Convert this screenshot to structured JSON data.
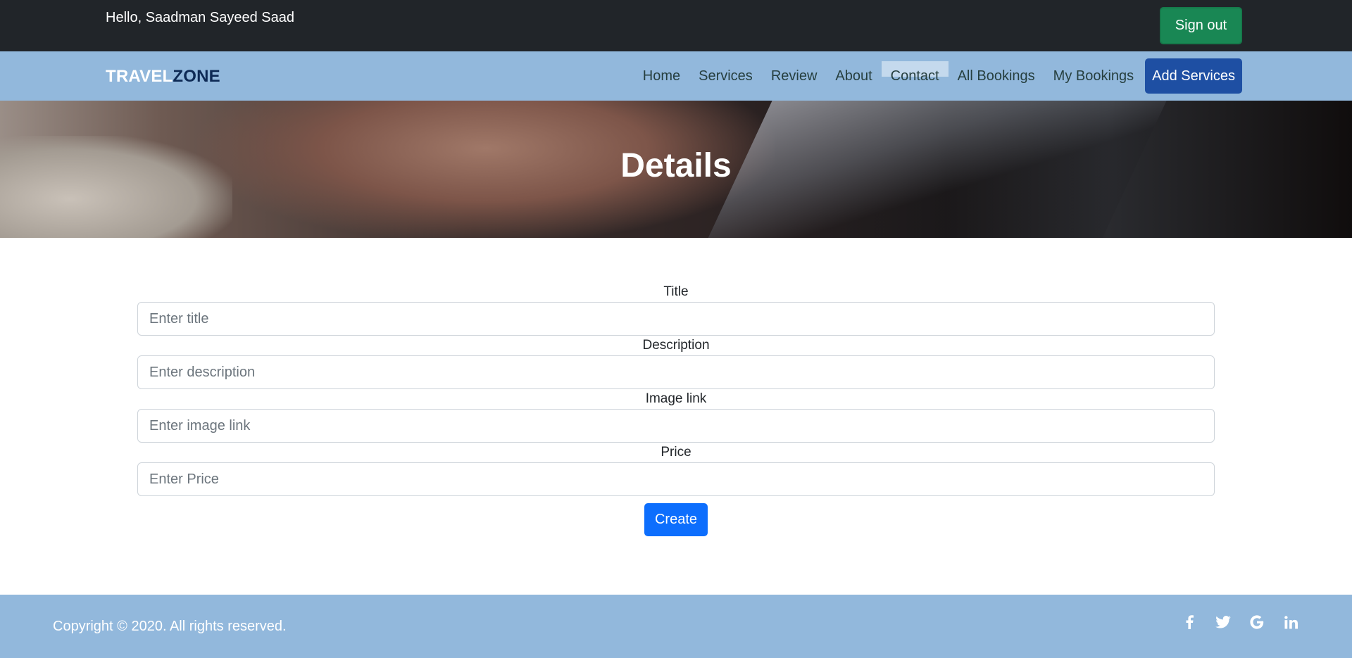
{
  "topbar": {
    "greeting": "Hello, Saadman Sayeed Saad",
    "signout_label": "Sign out"
  },
  "navbar": {
    "brand_part1": "TRAVEL",
    "brand_part2": "ZONE",
    "links": [
      {
        "label": "Home"
      },
      {
        "label": "Services"
      },
      {
        "label": "Review"
      },
      {
        "label": "About"
      },
      {
        "label": "Contact"
      },
      {
        "label": "All Bookings"
      },
      {
        "label": "My Bookings"
      }
    ],
    "add_services_label": "Add Services"
  },
  "hero": {
    "title": "Details"
  },
  "form": {
    "fields": [
      {
        "label": "Title",
        "placeholder": "Enter title",
        "value": ""
      },
      {
        "label": "Description",
        "placeholder": "Enter description",
        "value": ""
      },
      {
        "label": "Image link",
        "placeholder": "Enter image link",
        "value": ""
      },
      {
        "label": "Price",
        "placeholder": "Enter Price",
        "value": ""
      }
    ],
    "submit_label": "Create"
  },
  "footer": {
    "copyright": "Copyright © 2020. All rights reserved.",
    "socials": [
      "facebook-icon",
      "twitter-icon",
      "google-icon",
      "linkedin-icon"
    ]
  },
  "colors": {
    "topbar_bg": "#212529",
    "navbar_bg": "#92b8dc",
    "signout_bg": "#198754",
    "add_services_bg": "#1e4fa3",
    "create_bg": "#0d6efd",
    "brand_dark": "#0e2a55"
  }
}
